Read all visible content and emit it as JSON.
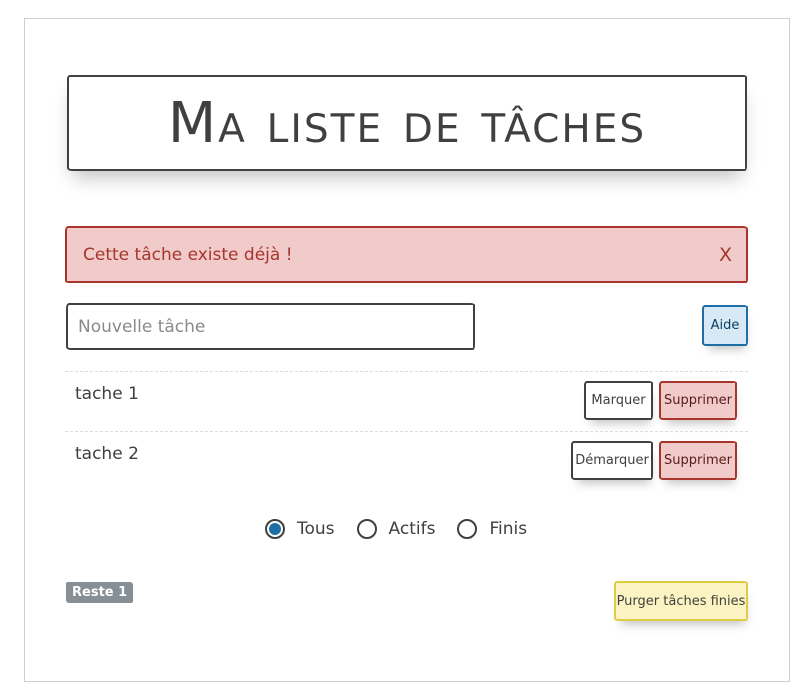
{
  "title": "Ma liste de tâches",
  "alert": {
    "message": "Cette tâche existe déjà !",
    "close_label": "X"
  },
  "new_task": {
    "placeholder": "Nouvelle tâche",
    "value": ""
  },
  "help_label": "Aide",
  "tasks": [
    {
      "label": "tache 1",
      "toggle_label": "Marquer",
      "delete_label": "Supprimer"
    },
    {
      "label": "tache 2",
      "toggle_label": "Démarquer",
      "delete_label": "Supprimer"
    }
  ],
  "filters": [
    {
      "label": "Tous",
      "checked": true
    },
    {
      "label": "Actifs",
      "checked": false
    },
    {
      "label": "Finis",
      "checked": false
    }
  ],
  "remaining_badge": "Reste 1",
  "purge_label": "Purger tâches finies",
  "colors": {
    "danger": "#a7342d",
    "danger_bg": "#f0cbc9",
    "primary": "#1c6ea4",
    "warning_bg": "#fbf4c2",
    "badge_bg": "#868e96"
  }
}
